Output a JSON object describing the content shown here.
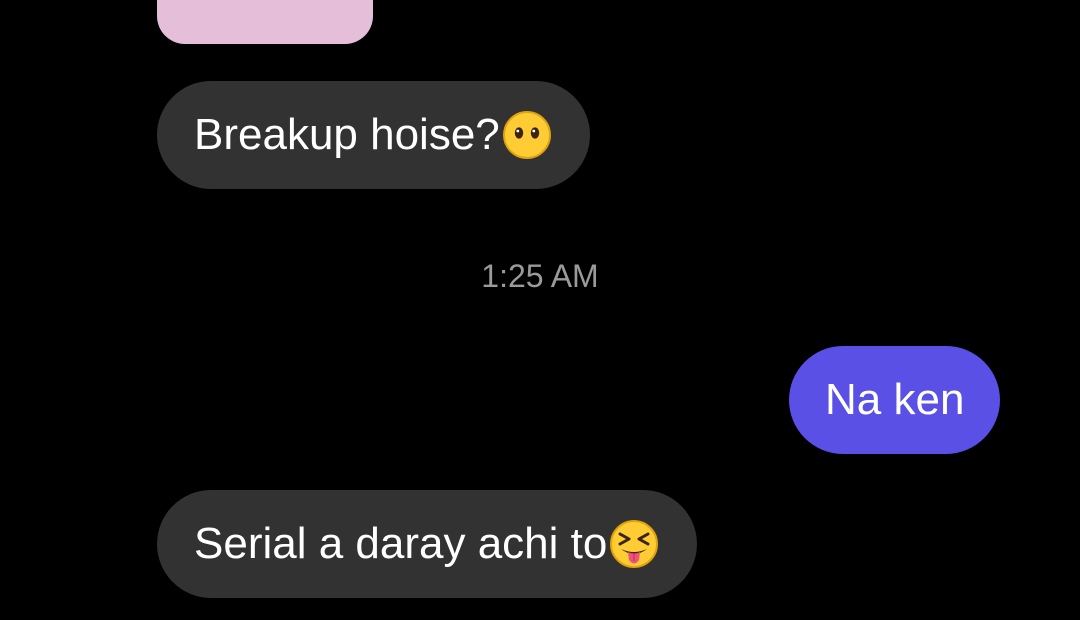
{
  "conversation": {
    "messages": [
      {
        "direction": "incoming",
        "text": "Breakup hoise?",
        "emoji": "face-without-mouth-emoji"
      },
      {
        "direction": "outgoing",
        "text": "Na ken"
      },
      {
        "direction": "incoming",
        "text": "Serial a daray achi to",
        "emoji": "squinting-face-with-tongue-emoji"
      }
    ],
    "timestamp": "1:25 AM"
  },
  "colors": {
    "background": "#000000",
    "incoming_bubble": "#323232",
    "outgoing_bubble": "#5a50e6",
    "partial_bubble": "#e5bfd9",
    "timestamp_text": "#9a9a9a"
  }
}
